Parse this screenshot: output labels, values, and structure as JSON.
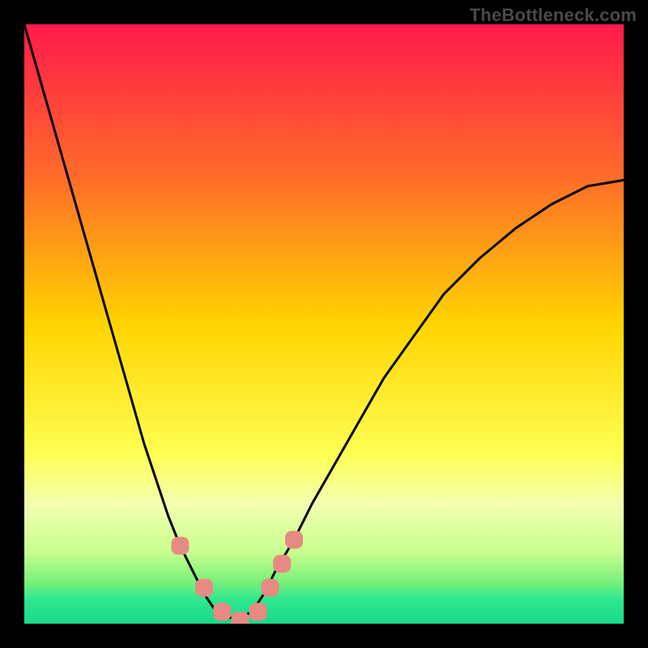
{
  "watermark": "TheBottleneck.com",
  "chart_data": {
    "type": "line",
    "title": "",
    "xlabel": "",
    "ylabel": "",
    "x": [
      0.0,
      0.02,
      0.04,
      0.06,
      0.08,
      0.1,
      0.12,
      0.14,
      0.16,
      0.18,
      0.2,
      0.22,
      0.24,
      0.26,
      0.28,
      0.3,
      0.32,
      0.34,
      0.36,
      0.38,
      0.4,
      0.42,
      0.45,
      0.48,
      0.52,
      0.56,
      0.6,
      0.65,
      0.7,
      0.76,
      0.82,
      0.88,
      0.94,
      1.0
    ],
    "values": [
      1.0,
      0.93,
      0.86,
      0.79,
      0.72,
      0.65,
      0.58,
      0.51,
      0.44,
      0.37,
      0.3,
      0.24,
      0.18,
      0.13,
      0.09,
      0.05,
      0.02,
      0.01,
      0.01,
      0.02,
      0.05,
      0.09,
      0.14,
      0.2,
      0.27,
      0.34,
      0.41,
      0.48,
      0.55,
      0.61,
      0.66,
      0.7,
      0.73,
      0.74
    ],
    "xlim": [
      0,
      1
    ],
    "ylim": [
      0,
      1
    ],
    "markers": {
      "x": [
        0.26,
        0.3,
        0.33,
        0.36,
        0.39,
        0.41,
        0.43,
        0.45
      ],
      "y": [
        0.13,
        0.06,
        0.02,
        0.005,
        0.02,
        0.06,
        0.1,
        0.14
      ]
    },
    "background_gradient": {
      "stops": [
        {
          "offset": 0.0,
          "color": "#ff1a4b"
        },
        {
          "offset": 0.25,
          "color": "#ff6a2a"
        },
        {
          "offset": 0.5,
          "color": "#ffd400"
        },
        {
          "offset": 0.72,
          "color": "#ffff55"
        },
        {
          "offset": 0.8,
          "color": "#f4ffb0"
        },
        {
          "offset": 0.88,
          "color": "#c8ff8f"
        },
        {
          "offset": 0.93,
          "color": "#7af07a"
        },
        {
          "offset": 0.96,
          "color": "#2ee88f"
        },
        {
          "offset": 1.0,
          "color": "#18d98a"
        }
      ]
    }
  }
}
